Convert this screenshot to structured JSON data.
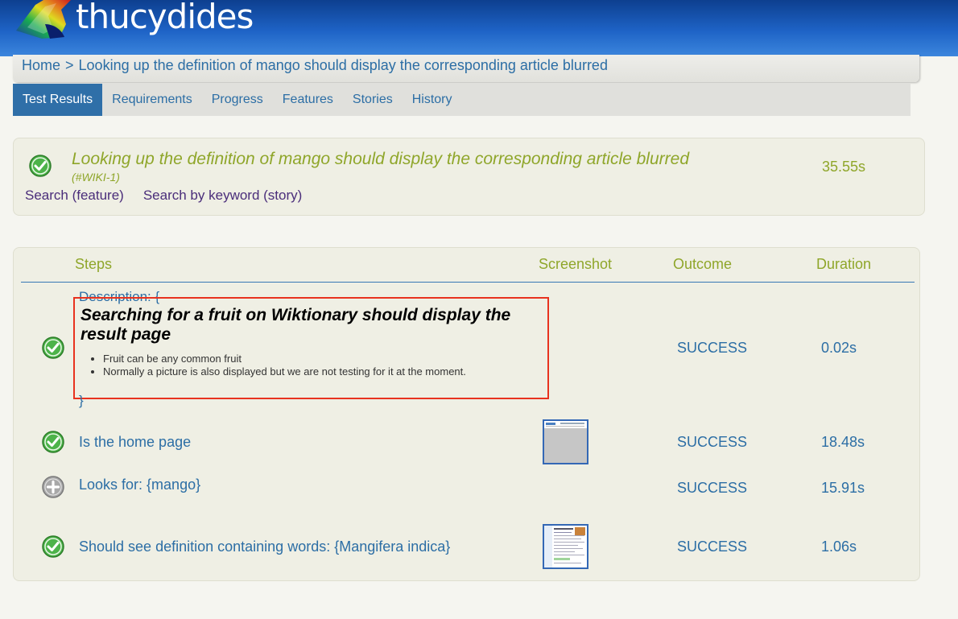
{
  "app": {
    "name": "thucydides"
  },
  "breadcrumb": {
    "home": "Home",
    "separator": ">",
    "current": "Looking up the definition of mango should display the corresponding article blurred"
  },
  "tabs": [
    {
      "label": "Test Results",
      "active": true
    },
    {
      "label": "Requirements",
      "active": false
    },
    {
      "label": "Progress",
      "active": false
    },
    {
      "label": "Features",
      "active": false
    },
    {
      "label": "Stories",
      "active": false
    },
    {
      "label": "History",
      "active": false
    }
  ],
  "test": {
    "status_icon": "check-circle-icon",
    "title": "Looking up the definition of mango should display the corresponding article blurred",
    "id": "(#WIKI-1)",
    "duration": "35.55s",
    "tags": [
      "Search (feature)",
      "Search by keyword (story)"
    ]
  },
  "steps_table": {
    "headers": {
      "steps": "Steps",
      "screenshot": "Screenshot",
      "outcome": "Outcome",
      "duration": "Duration"
    },
    "description": {
      "open": "Description: {",
      "close": "}",
      "heading": "Searching for a fruit on Wiktionary should display the result page",
      "bullets": [
        "Fruit can be any common fruit",
        "Normally a picture is also displayed but we are not testing for it at the moment."
      ],
      "outcome": "SUCCESS",
      "duration": "0.02s",
      "icon": "check-circle-icon"
    },
    "steps": [
      {
        "text": "Is the home page",
        "outcome": "SUCCESS",
        "duration": "18.48s",
        "icon": "check-circle-icon",
        "has_screenshot": true
      },
      {
        "text": "Looks for: {mango}",
        "outcome": "SUCCESS",
        "duration": "15.91s",
        "icon": "plus-circle-icon",
        "has_screenshot": false
      },
      {
        "text": "Should see definition containing words: {Mangifera indica}",
        "outcome": "SUCCESS",
        "duration": "1.06s",
        "icon": "check-circle-icon",
        "has_screenshot": true
      }
    ]
  },
  "colors": {
    "header": "#1e63c6",
    "active_tab": "#2f6fa8",
    "link": "#2c6ea5",
    "title_green": "#8fa62a",
    "highlight_border": "#e8321f"
  }
}
